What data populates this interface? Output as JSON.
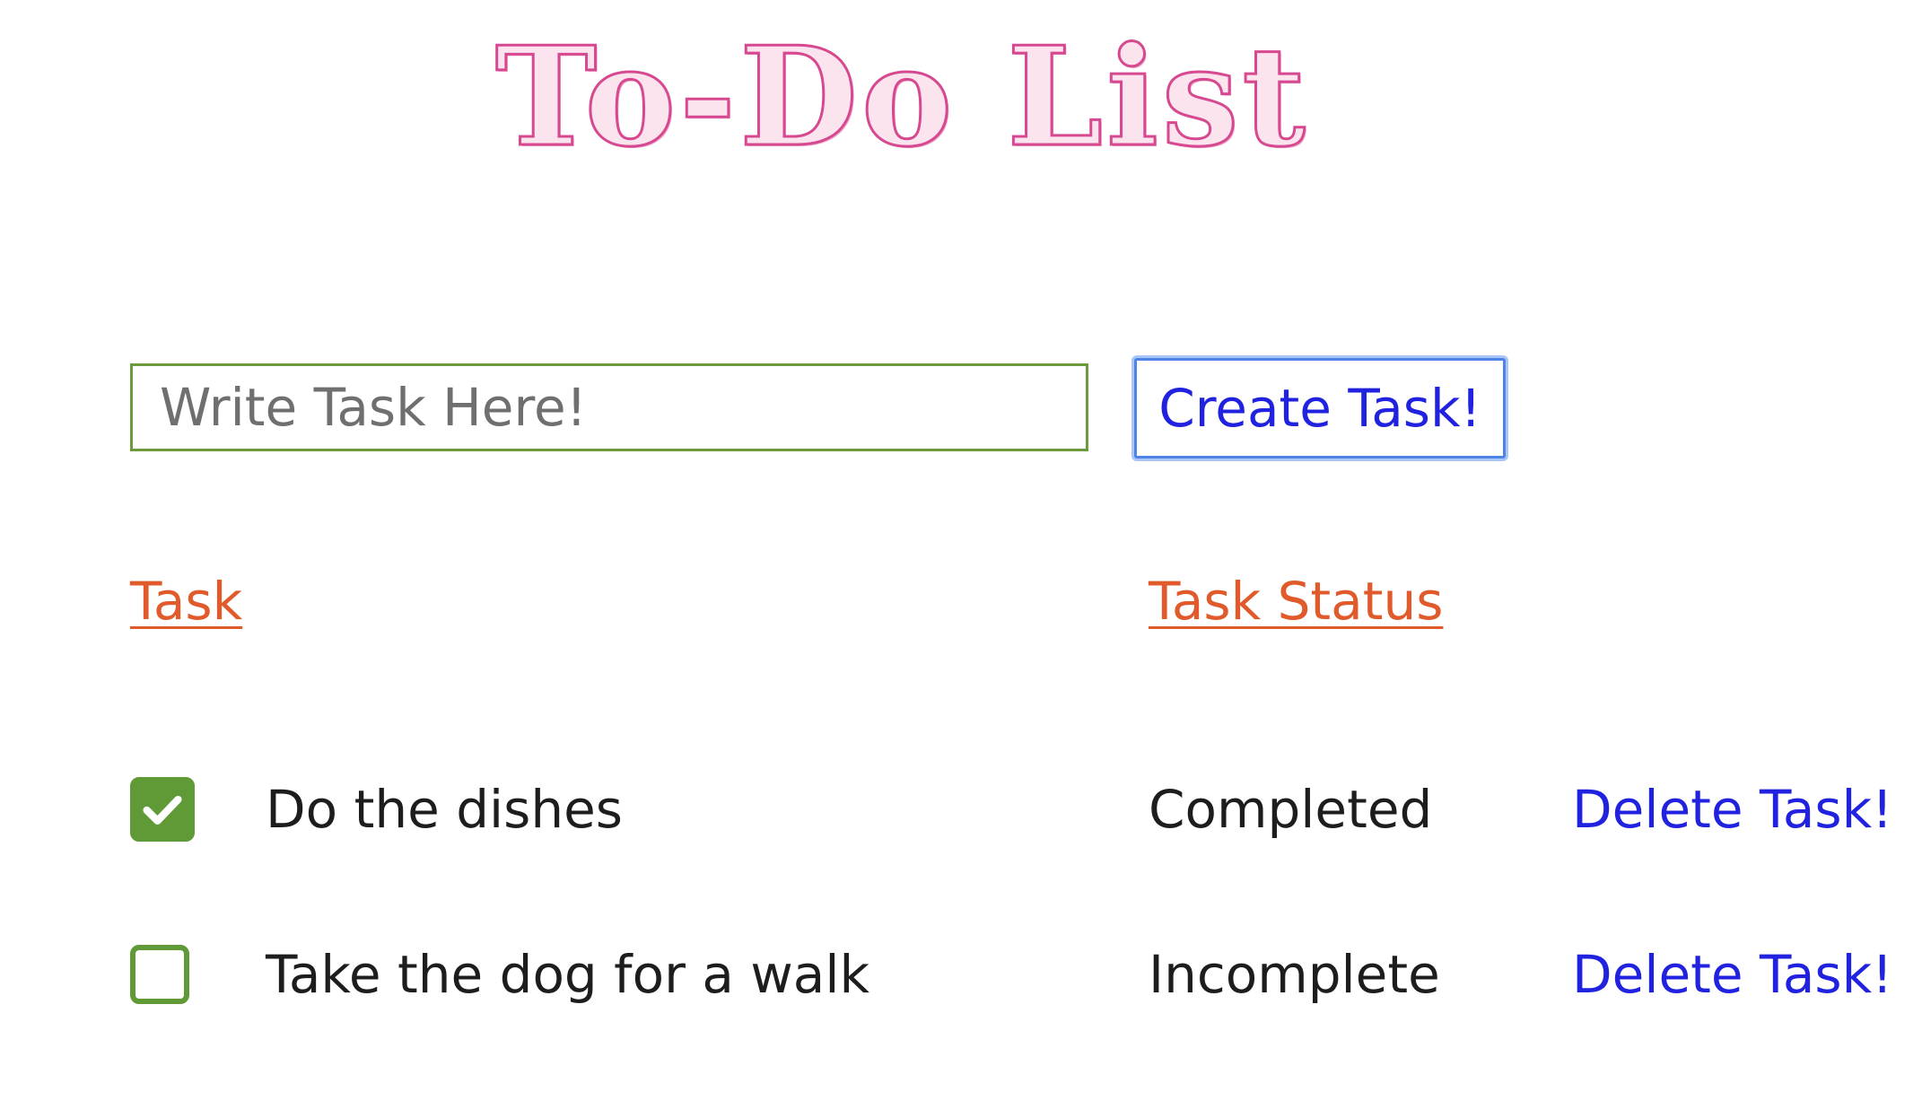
{
  "app": {
    "title": "To-Do List"
  },
  "form": {
    "placeholder": "Write Task Here!",
    "value": "",
    "create_label": "Create Task!"
  },
  "table": {
    "headers": {
      "task": "Task",
      "status": "Task Status"
    },
    "rows": [
      {
        "task": "Do the dishes",
        "checked": true,
        "status": "Completed",
        "delete_label": "Delete Task!"
      },
      {
        "task": "Take the dog for a walk",
        "checked": false,
        "status": "Incomplete",
        "delete_label": "Delete Task!"
      }
    ]
  },
  "colors": {
    "title": "#d6488f",
    "input_border": "#6a9a3c",
    "button_text": "#2121e0",
    "button_focus": "#4d84e6",
    "header": "#e05a2b",
    "checkbox": "#5f9a36",
    "link": "#2121e0"
  },
  "icons": {
    "checked": "checkmark-icon"
  }
}
